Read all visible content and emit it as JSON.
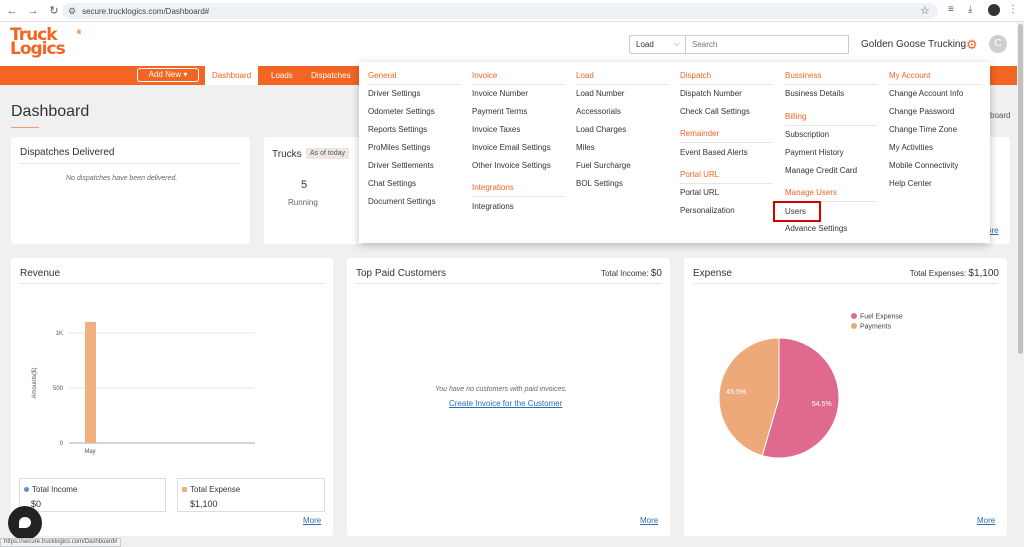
{
  "browser": {
    "url": "secure.trucklogics.com/Dashboard#",
    "status_url": "https://secure.trucklogics.com/Dashboard#"
  },
  "header": {
    "logo_line1": "Truck",
    "logo_line2": "Logics",
    "logo_reg": "®",
    "search_type": "Load",
    "search_placeholder": "Search",
    "company": "Golden Goose Trucking",
    "avatar_initial": "C"
  },
  "nav": {
    "add_new": "Add New ▾",
    "tabs": [
      "Dashboard",
      "Loads",
      "Dispatches"
    ]
  },
  "page": {
    "title": "Dashboard",
    "right_hint": "board"
  },
  "menu": {
    "general": {
      "head": "General",
      "items": [
        "Driver Settings",
        "Odometer Settings",
        "Reports Settings",
        "ProMiles Settings",
        "Driver Settlements",
        "Chat Settings",
        "Document Settings"
      ]
    },
    "invoice": {
      "head": "Invoice",
      "items": [
        "Invoice Number",
        "Payment Terms",
        "Invoice Taxes",
        "Invoice Email Settings",
        "Other Invoice Settings"
      ]
    },
    "integrations": {
      "head": "Integrations",
      "items": [
        "Integrations"
      ]
    },
    "load": {
      "head": "Load",
      "items": [
        "Load Number",
        "Accessorials",
        "Load Charges",
        "Miles",
        "Fuel Surcharge",
        "BOL Settings"
      ]
    },
    "dispatch": {
      "head": "Dispatch",
      "items": [
        "Dispatch Number",
        "Check Call Settings"
      ]
    },
    "remainder": {
      "head": "Remainder",
      "items": [
        "Event Based Alerts"
      ]
    },
    "portal": {
      "head": "Portal URL",
      "items": [
        "Portal URL",
        "Personalization"
      ]
    },
    "business": {
      "head": "Bussiness",
      "items": [
        "Business Details"
      ]
    },
    "billing": {
      "head": "Billing",
      "items": [
        "Subscription",
        "Payment History",
        "Manage Credit Card"
      ]
    },
    "manage_users": {
      "head": "Manage Users",
      "items": [
        "Users",
        "Advance Settings"
      ]
    },
    "account": {
      "head": "My Account",
      "items": [
        "Change Account Info",
        "Change Password",
        "Change Time Zone",
        "My Activities",
        "Mobile Connectivity",
        "Help Center"
      ]
    }
  },
  "cards": {
    "dispatches": {
      "title": "Dispatches Delivered",
      "empty": "No dispatches have been delivered."
    },
    "trucks": {
      "title": "Trucks",
      "badge": "As of today",
      "count": "5",
      "count_label": "Running"
    },
    "partial_right": {
      "d": "d",
      "more": "ore"
    },
    "revenue": {
      "title": "Revenue",
      "income_label": "Total Income",
      "income_value": "$0",
      "expense_label": "Total Expense",
      "expense_value": "$1,100",
      "more": "More"
    },
    "customers": {
      "title": "Top Paid Customers",
      "total_label": "Total Income:",
      "total_value": "$0",
      "empty": "You have no customers with paid invoices.",
      "link": "Create Invoice for the Customer",
      "more": "More"
    },
    "expense": {
      "title": "Expense",
      "total_label": "Total Expenses:",
      "total_value": "$1,100",
      "more": "More"
    }
  },
  "colors": {
    "brand": "#f26522",
    "income_dot": "#5b8fd9",
    "expense_bar": "#f0b080",
    "fuel": "#e06a8e",
    "payments": "#eda97a"
  },
  "chart_data": [
    {
      "type": "bar",
      "categories": [
        "May"
      ],
      "series": [
        {
          "name": "Total Expense",
          "values": [
            1100
          ]
        }
      ],
      "ylabel": "Amounts($)",
      "yticks": [
        "0",
        "500",
        "1K"
      ],
      "ylim": [
        0,
        1300
      ]
    },
    {
      "type": "pie",
      "labels": [
        "Fuel Expense",
        "Payments"
      ],
      "values": [
        54.5,
        45.5
      ],
      "value_labels": [
        "54.5%",
        "45.5%"
      ],
      "legend": "top-right"
    }
  ]
}
